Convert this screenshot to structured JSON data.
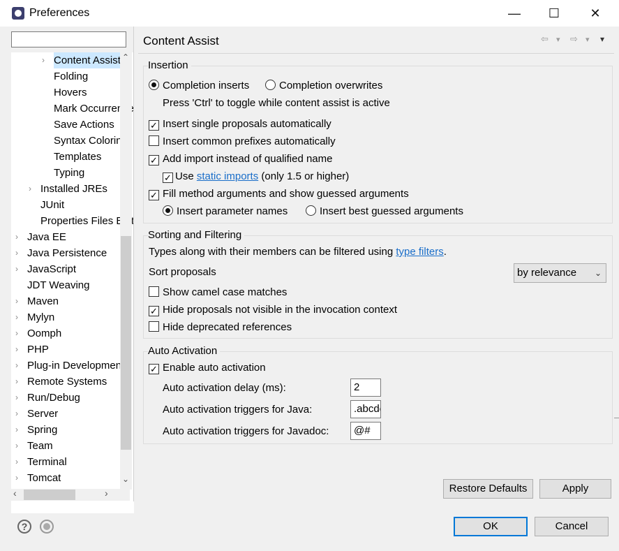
{
  "window": {
    "title": "Preferences",
    "minimize": "—",
    "maximize": "☐",
    "close": "✕"
  },
  "filter": {
    "value": ""
  },
  "tree": {
    "items": [
      {
        "label": "Content Assist",
        "arrow": "›"
      },
      {
        "label": "Folding",
        "arrow": ""
      },
      {
        "label": "Hovers",
        "arrow": ""
      },
      {
        "label": "Mark Occurrences",
        "arrow": ""
      },
      {
        "label": "Save Actions",
        "arrow": ""
      },
      {
        "label": "Syntax Coloring",
        "arrow": ""
      },
      {
        "label": "Templates",
        "arrow": ""
      },
      {
        "label": "Typing",
        "arrow": ""
      },
      {
        "label": "Installed JREs",
        "arrow": "›"
      },
      {
        "label": "JUnit",
        "arrow": ""
      },
      {
        "label": "Properties Files Editor",
        "arrow": ""
      },
      {
        "label": "Java EE",
        "arrow": "›"
      },
      {
        "label": "Java Persistence",
        "arrow": "›"
      },
      {
        "label": "JavaScript",
        "arrow": "›"
      },
      {
        "label": "JDT Weaving",
        "arrow": ""
      },
      {
        "label": "Maven",
        "arrow": "›"
      },
      {
        "label": "Mylyn",
        "arrow": "›"
      },
      {
        "label": "Oomph",
        "arrow": "›"
      },
      {
        "label": "PHP",
        "arrow": "›"
      },
      {
        "label": "Plug-in Development",
        "arrow": "›"
      },
      {
        "label": "Remote Systems",
        "arrow": "›"
      },
      {
        "label": "Run/Debug",
        "arrow": "›"
      },
      {
        "label": "Server",
        "arrow": "›"
      },
      {
        "label": "Spring",
        "arrow": "›"
      },
      {
        "label": "Team",
        "arrow": "›"
      },
      {
        "label": "Terminal",
        "arrow": "›"
      },
      {
        "label": "Tomcat",
        "arrow": "›"
      }
    ],
    "scroll_up": "⌃",
    "scroll_down": "⌄",
    "scroll_left": "‹",
    "scroll_right": "›"
  },
  "page": {
    "title": "Content Assist",
    "nav_back": "⇦",
    "nav_forward": "⇨",
    "nav_menu": "▾"
  },
  "insertion": {
    "title": "Insertion",
    "completion_inserts": "Completion inserts",
    "completion_overwrites": "Completion overwrites",
    "ctrl_hint": "Press 'Ctrl' to toggle while content assist is active",
    "insert_single": "Insert single proposals automatically",
    "insert_common": "Insert common prefixes automatically",
    "add_import": "Add import instead of qualified name",
    "use_label": "Use",
    "static_imports_link": "static imports",
    "static_imports_suffix": "(only 1.5 or higher)",
    "fill_method": "Fill method arguments and show guessed arguments",
    "insert_param_names": "Insert parameter names",
    "insert_best_guessed": "Insert best guessed arguments"
  },
  "sorting": {
    "title": "Sorting and Filtering",
    "types_text": "Types along with their members can be filtered using",
    "type_filters_link": "type filters",
    "period": ".",
    "sort_proposals": "Sort proposals",
    "sort_value": "by relevance",
    "show_camel": "Show camel case matches",
    "hide_not_visible": "Hide proposals not visible in the invocation context",
    "hide_deprecated": "Hide deprecated references"
  },
  "auto_activation": {
    "title": "Auto Activation",
    "enable": "Enable auto activation",
    "delay_label": "Auto activation delay (ms):",
    "delay_value": "2",
    "java_triggers_label": "Auto activation triggers for Java:",
    "java_triggers_value": ".abcdefghijklmnopqrstuvwxyz",
    "javadoc_triggers_label": "Auto activation triggers for Javadoc:",
    "javadoc_triggers_value": "@#"
  },
  "buttons": {
    "restore_defaults": "Restore Defaults",
    "apply": "Apply",
    "ok": "OK",
    "cancel": "Cancel"
  },
  "bottom": {
    "help_glyph": "?"
  },
  "checks": {
    "mark": "✓"
  }
}
